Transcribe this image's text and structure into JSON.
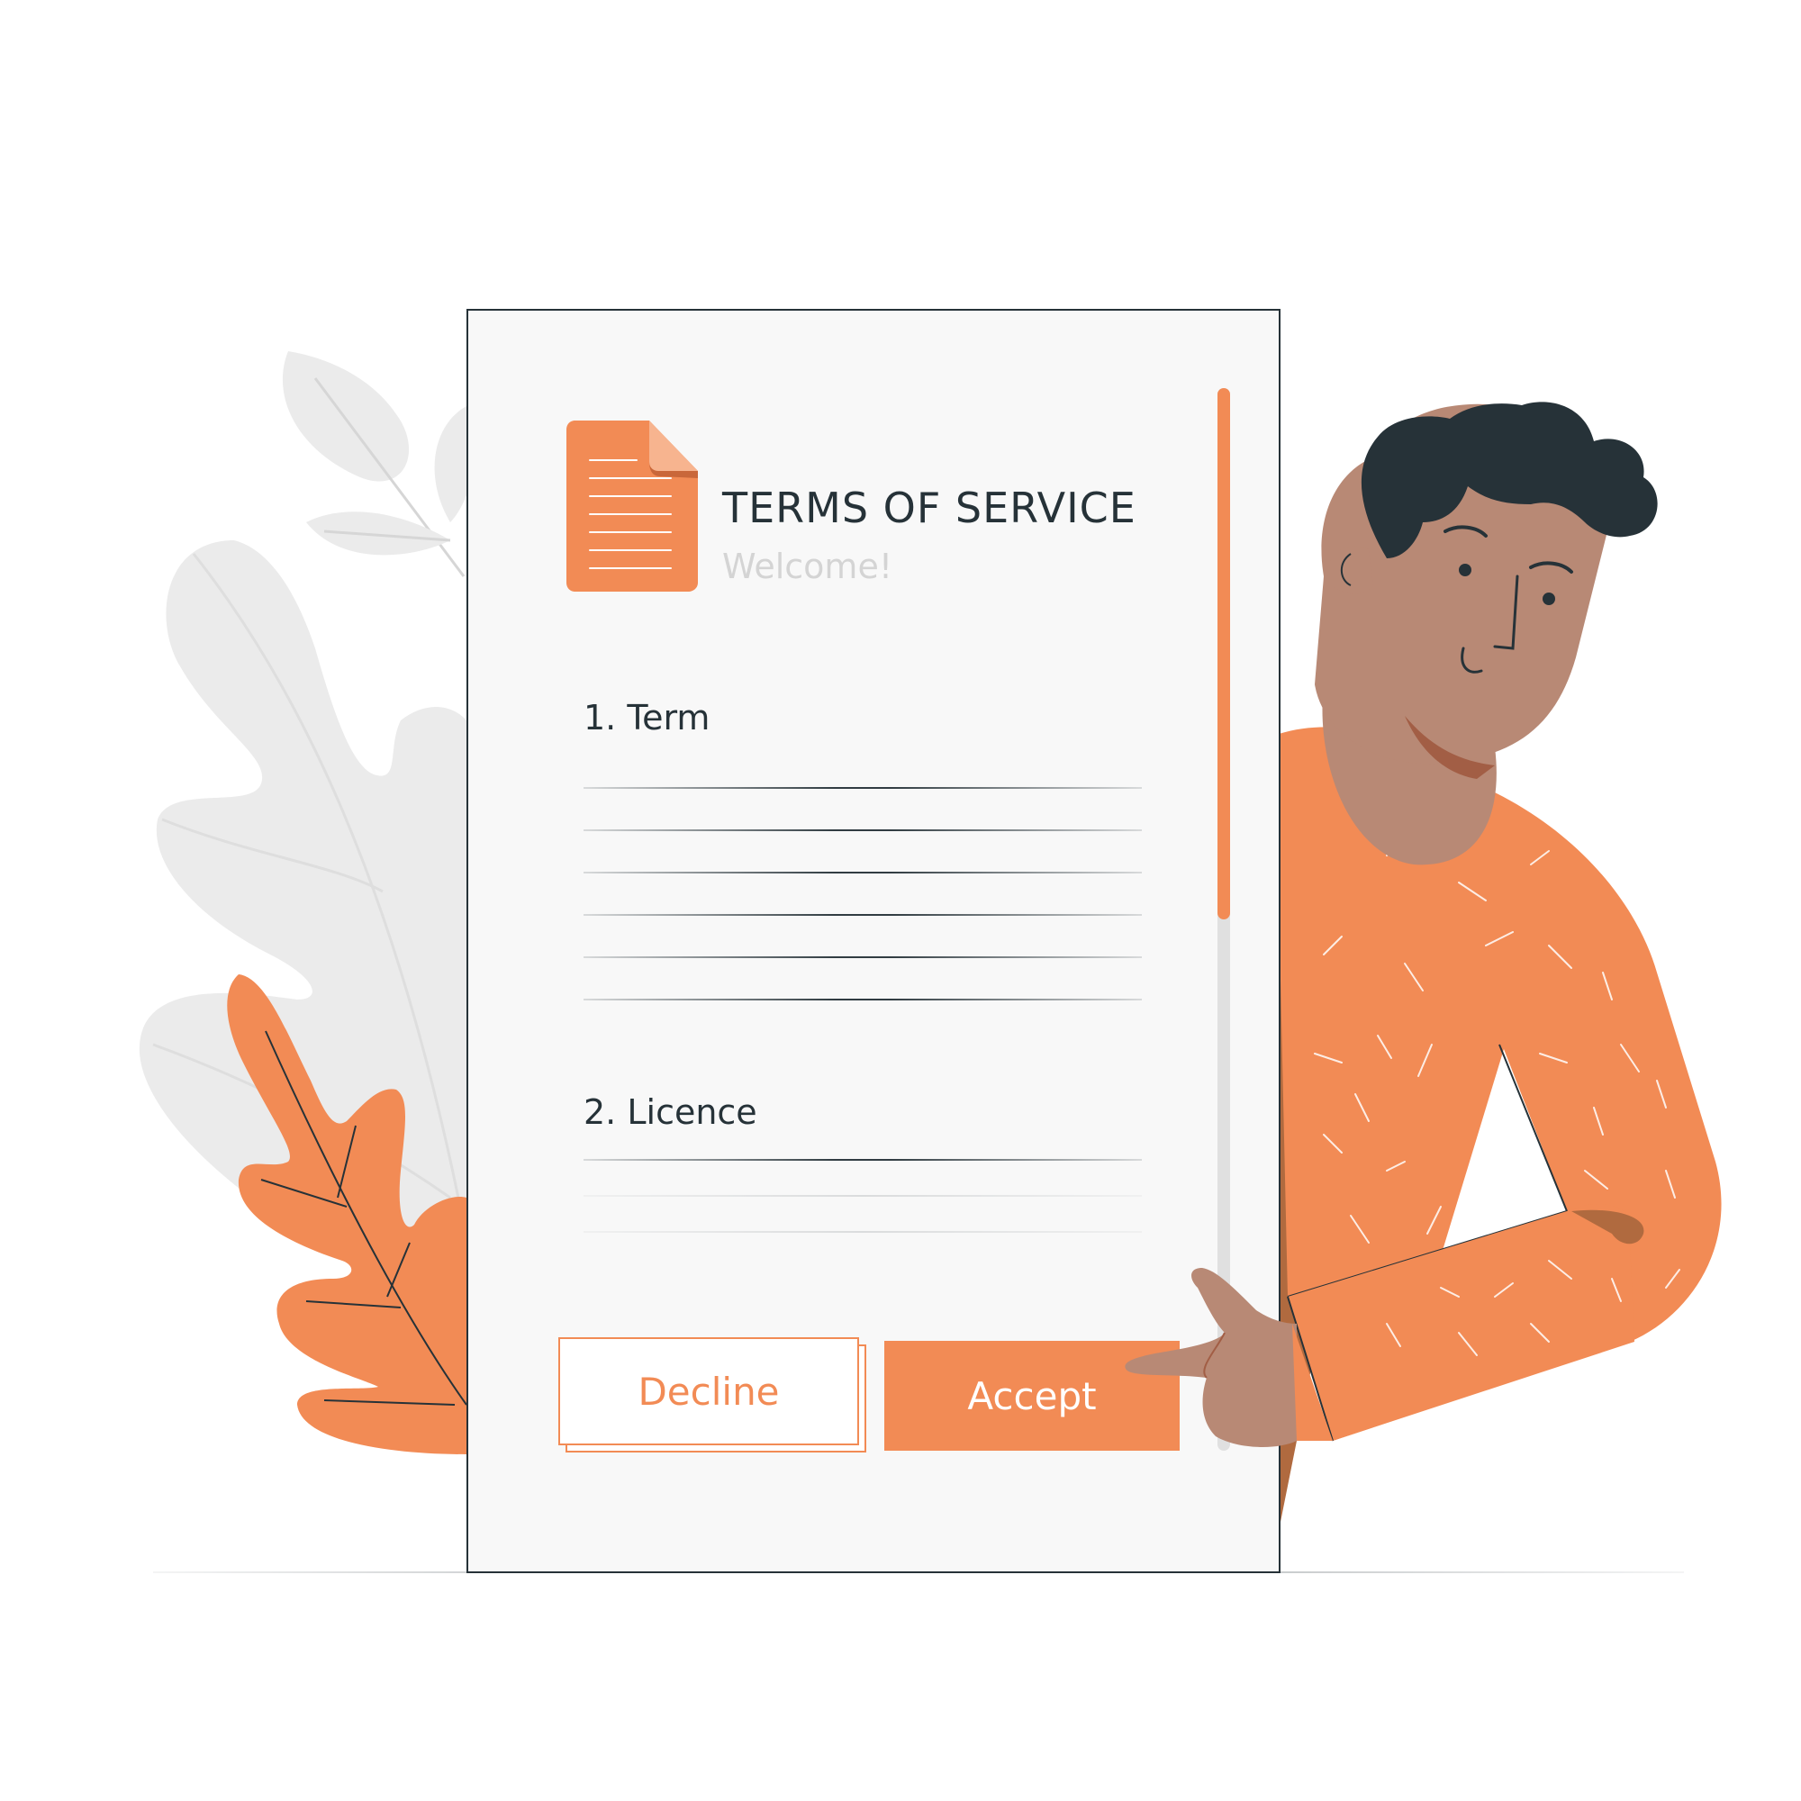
{
  "document": {
    "title": "TERMS OF SERVICE",
    "subtitle": "Welcome!",
    "icon": "document-icon",
    "sections": [
      {
        "heading": "1. Term"
      },
      {
        "heading": "2. Licence"
      }
    ]
  },
  "actions": {
    "decline_label": "Decline",
    "accept_label": "Accept"
  },
  "scrollbar": {
    "thumb_fraction": 0.5
  },
  "colors": {
    "accent": "#f28b55",
    "ink": "#263238",
    "muted": "#d4d4d4",
    "skin": "#b88975",
    "leaf_gray": "#ebebeb"
  }
}
